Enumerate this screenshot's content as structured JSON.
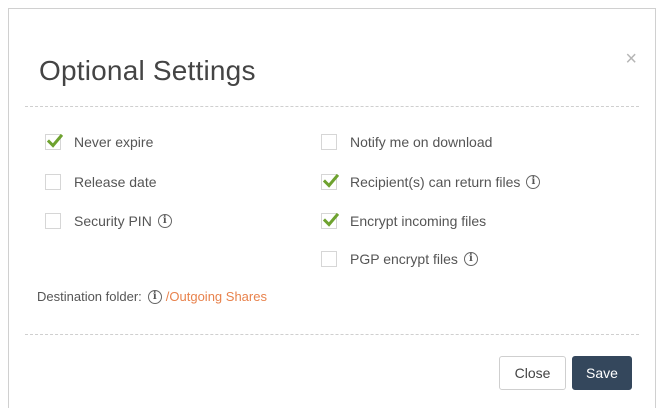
{
  "dialog": {
    "title": "Optional Settings",
    "close_glyph": "×"
  },
  "options_left": [
    {
      "label": "Never expire",
      "checked": true,
      "info": false
    },
    {
      "label": "Release date",
      "checked": false,
      "info": false
    },
    {
      "label": "Security PIN",
      "checked": false,
      "info": true
    }
  ],
  "options_right": [
    {
      "label": "Notify me on download",
      "checked": false,
      "info": false
    },
    {
      "label": "Recipient(s) can return files",
      "checked": true,
      "info": true
    },
    {
      "label": "Encrypt incoming files",
      "checked": true,
      "info": false
    },
    {
      "label": "PGP encrypt files",
      "checked": false,
      "info": true
    }
  ],
  "destination": {
    "label": "Destination folder:",
    "folder_link": "/Outgoing Shares"
  },
  "info_glyph": "i",
  "buttons": {
    "close": "Close",
    "save": "Save"
  },
  "colors": {
    "check": "#6ea22f",
    "link": "#e8824c",
    "save_bg": "#34475c"
  }
}
